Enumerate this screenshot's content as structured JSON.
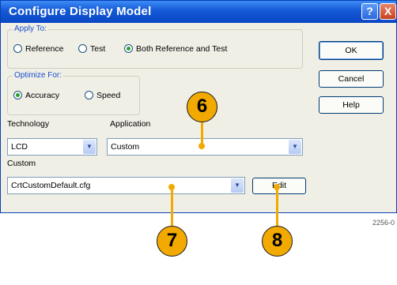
{
  "window": {
    "title": "Configure Display Model",
    "help_glyph": "?",
    "close_glyph": "X"
  },
  "apply_to": {
    "label": "Apply To:",
    "options": [
      "Reference",
      "Test",
      "Both Reference and Test"
    ],
    "selected": "Both Reference and Test"
  },
  "optimize_for": {
    "label": "Optimize For:",
    "options": [
      "Accuracy",
      "Speed"
    ],
    "selected": "Accuracy"
  },
  "buttons": {
    "ok": "OK",
    "cancel": "Cancel",
    "help": "Help",
    "edit": "Edit"
  },
  "technology": {
    "label": "Technology",
    "value": "LCD"
  },
  "application": {
    "label": "Application",
    "value": "Custom"
  },
  "custom": {
    "label": "Custom",
    "value": "CrtCustomDefault.cfg"
  },
  "callouts": [
    "6",
    "7",
    "8"
  ],
  "figure_id": "2256-0",
  "colors": {
    "title_bar": "#1358d6",
    "callout": "#f2a900",
    "dialog_bg": "#f0efe6"
  }
}
